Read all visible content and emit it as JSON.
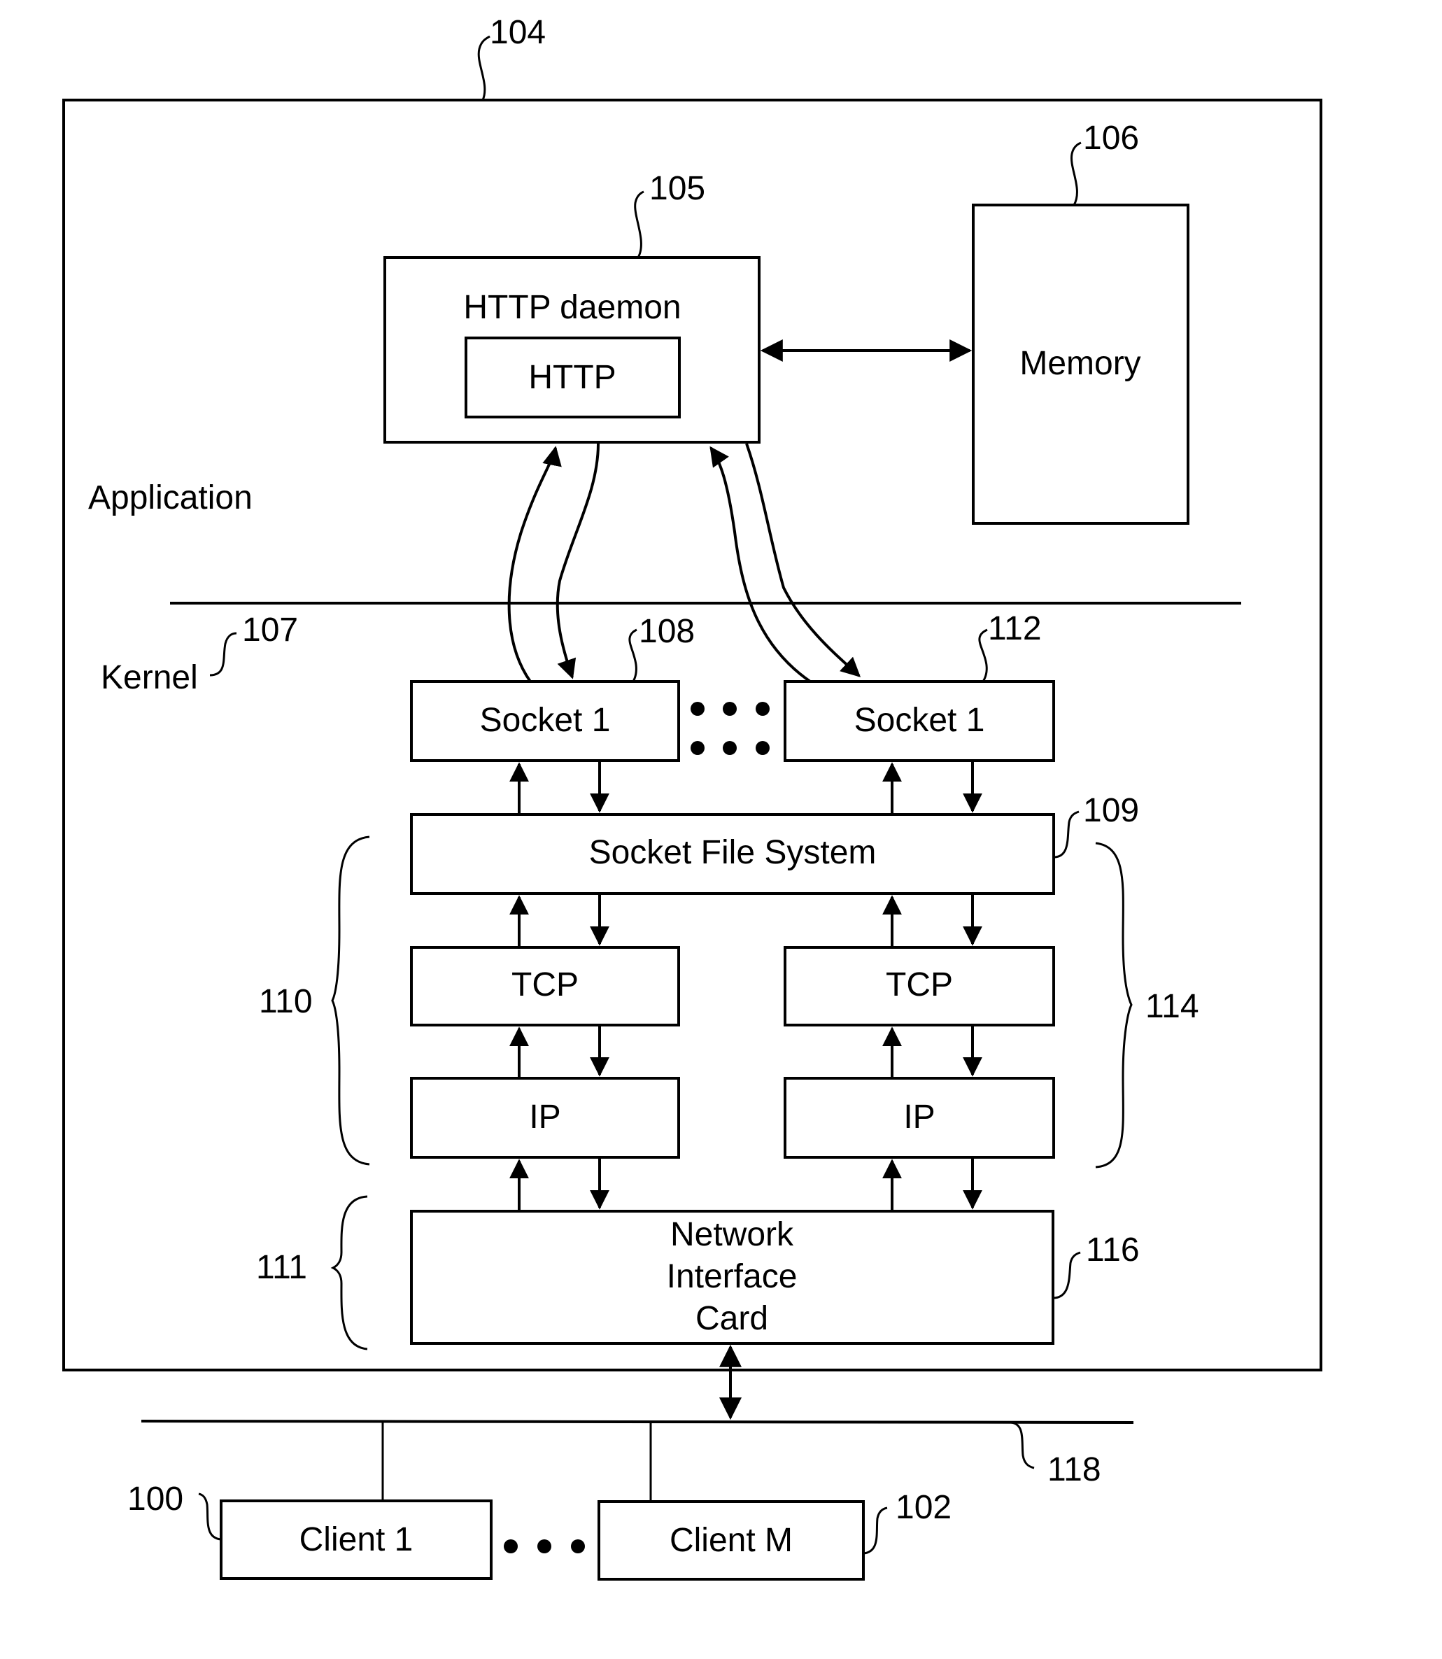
{
  "diagram": {
    "regions": {
      "application_label": "Application",
      "kernel_label": "Kernel"
    },
    "boxes": {
      "http_daemon": "HTTP daemon",
      "http": "HTTP",
      "memory": "Memory",
      "socket_a": "Socket 1",
      "socket_b": "Socket 1",
      "socket_fs": "Socket File System",
      "tcp_a": "TCP",
      "tcp_b": "TCP",
      "ip_a": "IP",
      "ip_b": "IP",
      "nic_line1": "Network",
      "nic_line2": "Interface",
      "nic_line3": "Card",
      "client_1": "Client 1",
      "client_m": "Client M"
    },
    "refs": {
      "server": "104",
      "http_daemon": "105",
      "memory": "106",
      "kernel": "107",
      "socket_a": "108",
      "socket_fs": "109",
      "stack_a": "110",
      "nic_group": "111",
      "socket_b": "112",
      "stack_b": "114",
      "nic": "116",
      "network": "118",
      "client_1": "100",
      "client_m": "102"
    },
    "colors": {
      "ink": "#000000",
      "background": "#ffffff"
    }
  }
}
